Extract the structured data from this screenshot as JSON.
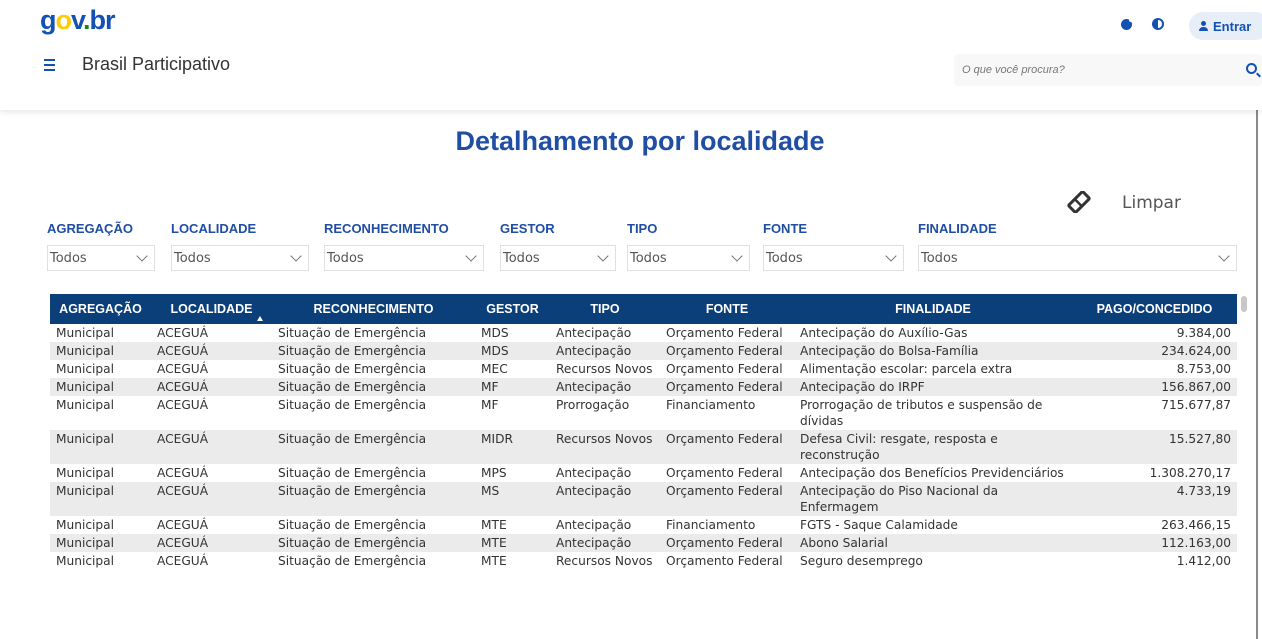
{
  "header": {
    "logo": {
      "g": "g",
      "o": "o",
      "v": "v",
      "dot": ".",
      "br": "br"
    },
    "site_title": "Brasil Participativo",
    "login_label": "Entrar",
    "search_placeholder": "O que você procura?",
    "icons": [
      "cookie-icon",
      "contrast-icon",
      "user-icon",
      "search-icon",
      "menu-icon"
    ]
  },
  "report": {
    "title": "Detalhamento por localidade",
    "clear_label": "Limpar",
    "filters": [
      {
        "label": "AGREGAÇÃO",
        "value": "Todos"
      },
      {
        "label": "LOCALIDADE",
        "value": "Todos"
      },
      {
        "label": "RECONHECIMENTO",
        "value": "Todos"
      },
      {
        "label": "GESTOR",
        "value": "Todos"
      },
      {
        "label": "TIPO",
        "value": "Todos"
      },
      {
        "label": "FONTE",
        "value": "Todos"
      },
      {
        "label": "FINALIDADE",
        "value": "Todos"
      }
    ],
    "table": {
      "columns": [
        "AGREGAÇÃO",
        "LOCALIDADE",
        "RECONHECIMENTO",
        "GESTOR",
        "TIPO",
        "FONTE",
        "FINALIDADE",
        "PAGO/CONCEDIDO"
      ],
      "sorted_column": "LOCALIDADE",
      "rows": [
        [
          "Municipal",
          "ACEGUÁ",
          "Situação de Emergência",
          "MDS",
          "Antecipação",
          "Orçamento Federal",
          "Antecipação do Auxílio-Gas",
          "9.384,00"
        ],
        [
          "Municipal",
          "ACEGUÁ",
          "Situação de Emergência",
          "MDS",
          "Antecipação",
          "Orçamento Federal",
          "Antecipação do Bolsa-Família",
          "234.624,00"
        ],
        [
          "Municipal",
          "ACEGUÁ",
          "Situação de Emergência",
          "MEC",
          "Recursos Novos",
          "Orçamento Federal",
          "Alimentação escolar: parcela extra",
          "8.753,00"
        ],
        [
          "Municipal",
          "ACEGUÁ",
          "Situação de Emergência",
          "MF",
          "Antecipação",
          "Orçamento Federal",
          "Antecipação do IRPF",
          "156.867,00"
        ],
        [
          "Municipal",
          "ACEGUÁ",
          "Situação de Emergência",
          "MF",
          "Prorrogação",
          "Financiamento",
          "Prorrogação de tributos e suspensão de dívidas",
          "715.677,87"
        ],
        [
          "Municipal",
          "ACEGUÁ",
          "Situação de Emergência",
          "MIDR",
          "Recursos Novos",
          "Orçamento Federal",
          "Defesa Civil: resgate, resposta e reconstrução",
          "15.527,80"
        ],
        [
          "Municipal",
          "ACEGUÁ",
          "Situação de Emergência",
          "MPS",
          "Antecipação",
          "Orçamento Federal",
          "Antecipação dos Benefícios Previdenciários",
          "1.308.270,17"
        ],
        [
          "Municipal",
          "ACEGUÁ",
          "Situação de Emergência",
          "MS",
          "Antecipação",
          "Orçamento Federal",
          "Antecipação do Piso Nacional da Enfermagem",
          "4.733,19"
        ],
        [
          "Municipal",
          "ACEGUÁ",
          "Situação de Emergência",
          "MTE",
          "Antecipação",
          "Financiamento",
          "FGTS - Saque Calamidade",
          "263.466,15"
        ],
        [
          "Municipal",
          "ACEGUÁ",
          "Situação de Emergência",
          "MTE",
          "Antecipação",
          "Orçamento Federal",
          "Abono Salarial",
          "112.163,00"
        ],
        [
          "Municipal",
          "ACEGUÁ",
          "Situação de Emergência",
          "MTE",
          "Recursos Novos",
          "Orçamento Federal",
          "Seguro desemprego",
          "1.412,00"
        ]
      ]
    }
  }
}
